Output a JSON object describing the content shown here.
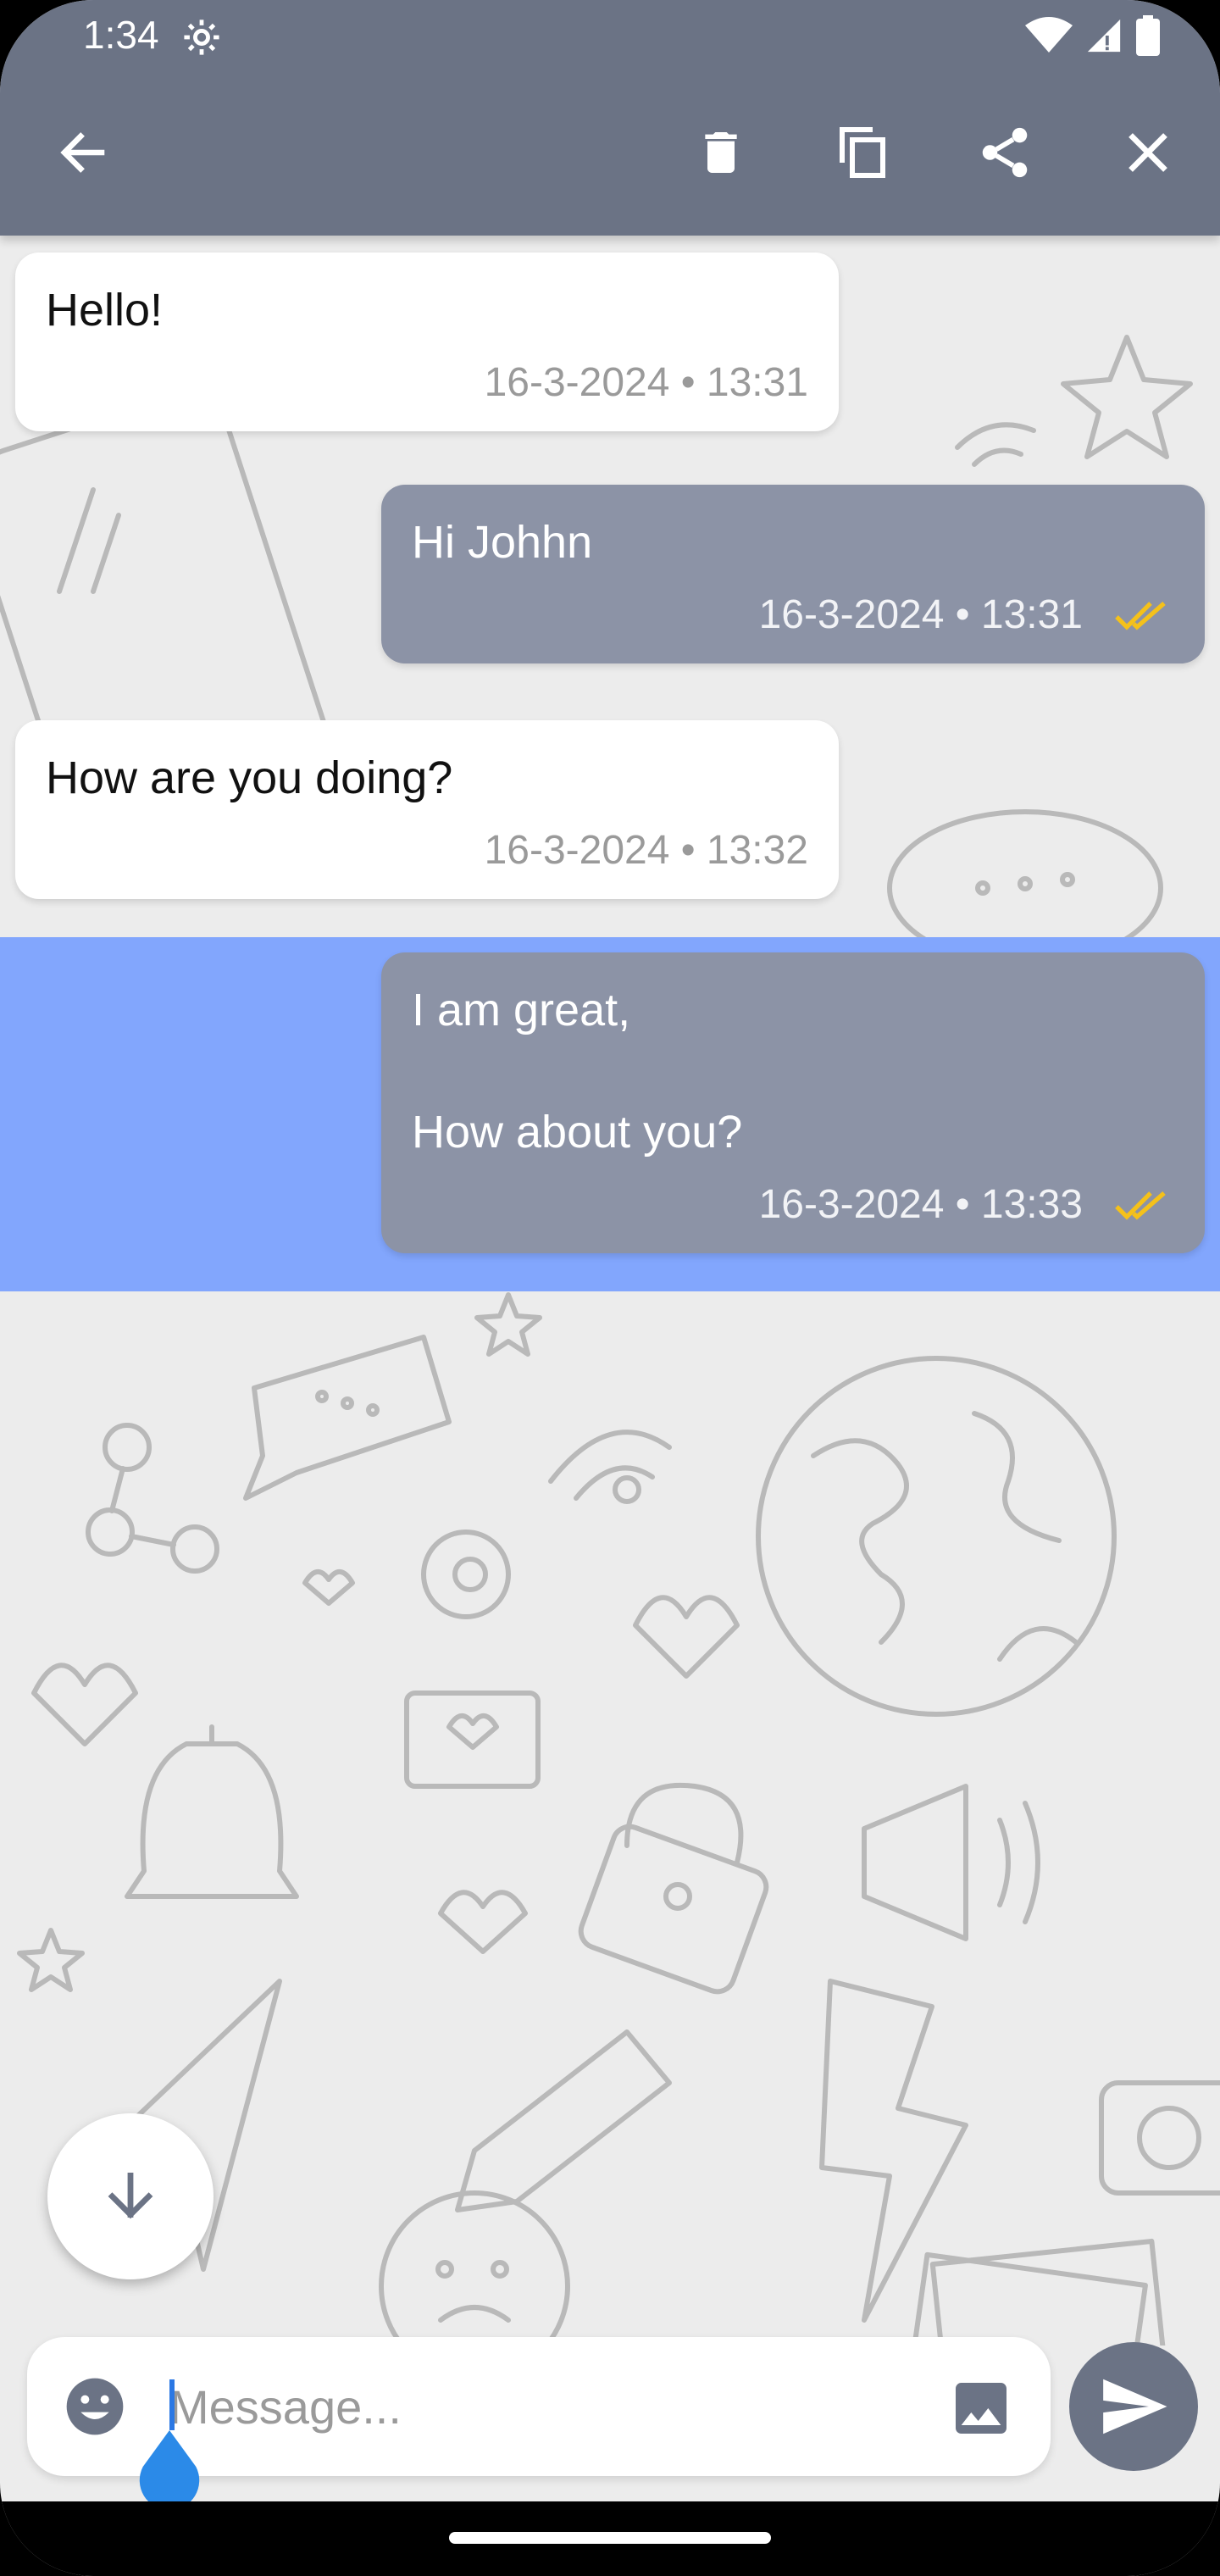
{
  "status_bar": {
    "time": "1:34"
  },
  "app_bar": {
    "icons": [
      "back-arrow-icon",
      "trash-icon",
      "copy-icon",
      "share-icon",
      "close-icon"
    ]
  },
  "messages": [
    {
      "direction": "in",
      "text": "Hello!",
      "timestamp": "16-3-2024 • 13:31"
    },
    {
      "direction": "out",
      "text": "Hi Johhn",
      "timestamp": "16-3-2024 • 13:31",
      "status": "read"
    },
    {
      "direction": "in",
      "text": "How are you doing?",
      "timestamp": "16-3-2024 • 13:32"
    },
    {
      "direction": "out",
      "text": "I am great,\n\nHow about you?",
      "timestamp": "16-3-2024 • 13:33",
      "status": "read",
      "selected": true
    }
  ],
  "composer": {
    "placeholder": "Message...",
    "value": ""
  },
  "colors": {
    "app_bar": "#6b7385",
    "outgoing_bubble": "#8c93a6",
    "incoming_bubble": "#ffffff",
    "selection": "#82a6fd",
    "read_ticks": "#f5c11a",
    "background": "#ececec"
  }
}
